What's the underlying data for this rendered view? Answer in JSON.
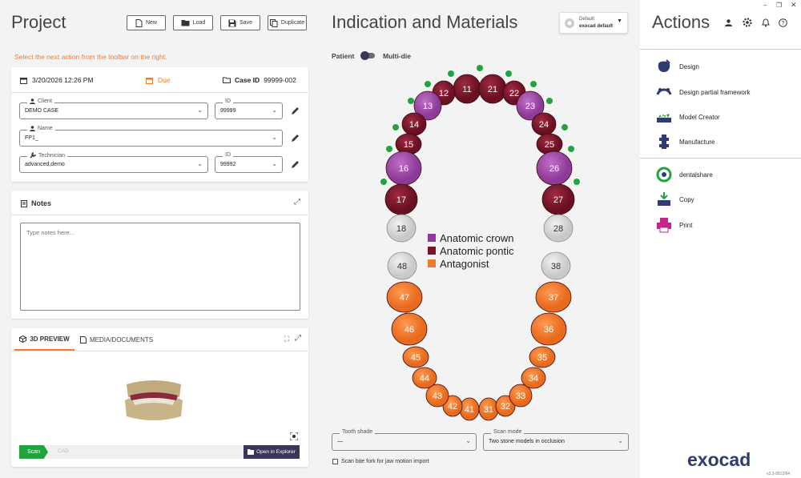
{
  "project": {
    "title": "Project",
    "hint": "Select the next action from the toolbar on the right.",
    "buttons": {
      "new": "New",
      "load": "Load",
      "save": "Save",
      "duplicate": "Duplicate"
    },
    "date": "3/20/2026 12:26 PM",
    "due": "Due",
    "case_id_label": "Case ID",
    "case_id": "99999-002",
    "client": {
      "label": "Client",
      "value": "DEMO CASE",
      "id_label": "ID",
      "id": "99999"
    },
    "name": {
      "label": "Name",
      "value": "FP1_"
    },
    "technician": {
      "label": "Technician",
      "value": "advanced,demo",
      "id_label": "ID",
      "id": "99992"
    },
    "notes": {
      "title": "Notes",
      "placeholder": "Type notes here..."
    },
    "preview": {
      "tab_3d": "3D PREVIEW",
      "tab_media": "MEDIA/DOCUMENTS",
      "scan": "Scan",
      "cad": "CAD",
      "open_explorer": "Open in Explorer"
    }
  },
  "indication": {
    "title": "Indication and Materials",
    "profile_line1": "Default",
    "profile_line2": "exocad default",
    "patient": "Patient",
    "multi_die": "Multi-die",
    "legend": [
      {
        "label": "Anatomic crown",
        "color": "#8e3a98"
      },
      {
        "label": "Anatomic pontic",
        "color": "#7a1428"
      },
      {
        "label": "Antagonist",
        "color": "#f07b2e"
      }
    ],
    "teeth": {
      "upper": [
        "11",
        "12",
        "13",
        "14",
        "15",
        "16",
        "17",
        "18",
        "21",
        "22",
        "23",
        "24",
        "25",
        "26",
        "27",
        "28"
      ],
      "lower": [
        "31",
        "32",
        "33",
        "34",
        "35",
        "36",
        "37",
        "38",
        "41",
        "42",
        "43",
        "44",
        "45",
        "46",
        "47",
        "48"
      ]
    },
    "tooth_shade": {
      "label": "Tooth shade",
      "value": "—"
    },
    "scan_mode": {
      "label": "Scan mode",
      "value": "Two stone models in occlusion"
    },
    "bite_fork": "Scan bite fork for jaw motion import"
  },
  "actions": {
    "title": "Actions",
    "items": [
      "Design",
      "Design partial framework",
      "Model Creator",
      "Manufacture",
      "dentalshare",
      "Copy",
      "Print"
    ],
    "logo": "exocad",
    "version": "v3.3-9512/64"
  },
  "colors": {
    "accent": "#f07b2e",
    "crown": "#8e3a98",
    "pontic": "#7a1428",
    "antagonist": "#f07b2e",
    "green": "#22a33e",
    "brand": "#3a3a8c"
  }
}
